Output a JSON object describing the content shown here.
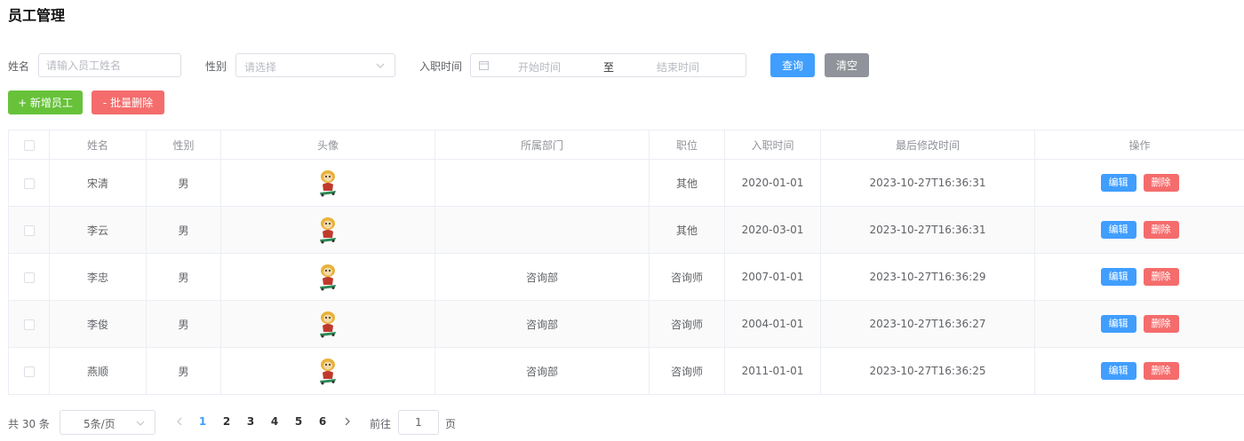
{
  "page": {
    "title": "员工管理"
  },
  "search": {
    "name_label": "姓名",
    "name_placeholder": "请输入员工姓名",
    "gender_label": "性别",
    "gender_placeholder": "请选择",
    "date_label": "入职时间",
    "date_start_placeholder": "开始时间",
    "date_separator": "至",
    "date_end_placeholder": "结束时间",
    "query_label": "查询",
    "clear_label": "清空"
  },
  "actions": {
    "add_label": "+ 新增员工",
    "batch_delete_label": "- 批量删除"
  },
  "table": {
    "columns": [
      "姓名",
      "性别",
      "头像",
      "所属部门",
      "职位",
      "入职时间",
      "最后修改时间",
      "操作"
    ],
    "rows": [
      {
        "name": "宋清",
        "gender": "男",
        "avatar": "avatar-icon",
        "dept": "",
        "position": "其他",
        "entry_date": "2020-01-01",
        "updated": "2023-10-27T16:36:31"
      },
      {
        "name": "李云",
        "gender": "男",
        "avatar": "avatar-icon",
        "dept": "",
        "position": "其他",
        "entry_date": "2020-03-01",
        "updated": "2023-10-27T16:36:31"
      },
      {
        "name": "李忠",
        "gender": "男",
        "avatar": "avatar-icon",
        "dept": "咨询部",
        "position": "咨询师",
        "entry_date": "2007-01-01",
        "updated": "2023-10-27T16:36:29"
      },
      {
        "name": "李俊",
        "gender": "男",
        "avatar": "avatar-icon",
        "dept": "咨询部",
        "position": "咨询师",
        "entry_date": "2004-01-01",
        "updated": "2023-10-27T16:36:27"
      },
      {
        "name": "燕顺",
        "gender": "男",
        "avatar": "avatar-icon",
        "dept": "咨询部",
        "position": "咨询师",
        "entry_date": "2011-01-01",
        "updated": "2023-10-27T16:36:25"
      }
    ],
    "edit_label": "编辑",
    "delete_label": "删除"
  },
  "pagination": {
    "total_text": "共 30 条",
    "page_size": "5条/页",
    "pages": [
      "1",
      "2",
      "3",
      "4",
      "5",
      "6"
    ],
    "current_page": "1",
    "goto_label": "前往",
    "goto_value": "1",
    "goto_unit": "页"
  },
  "colors": {
    "primary": "#409eff",
    "success": "#67c23a",
    "danger": "#f56c6c",
    "info": "#909399"
  }
}
